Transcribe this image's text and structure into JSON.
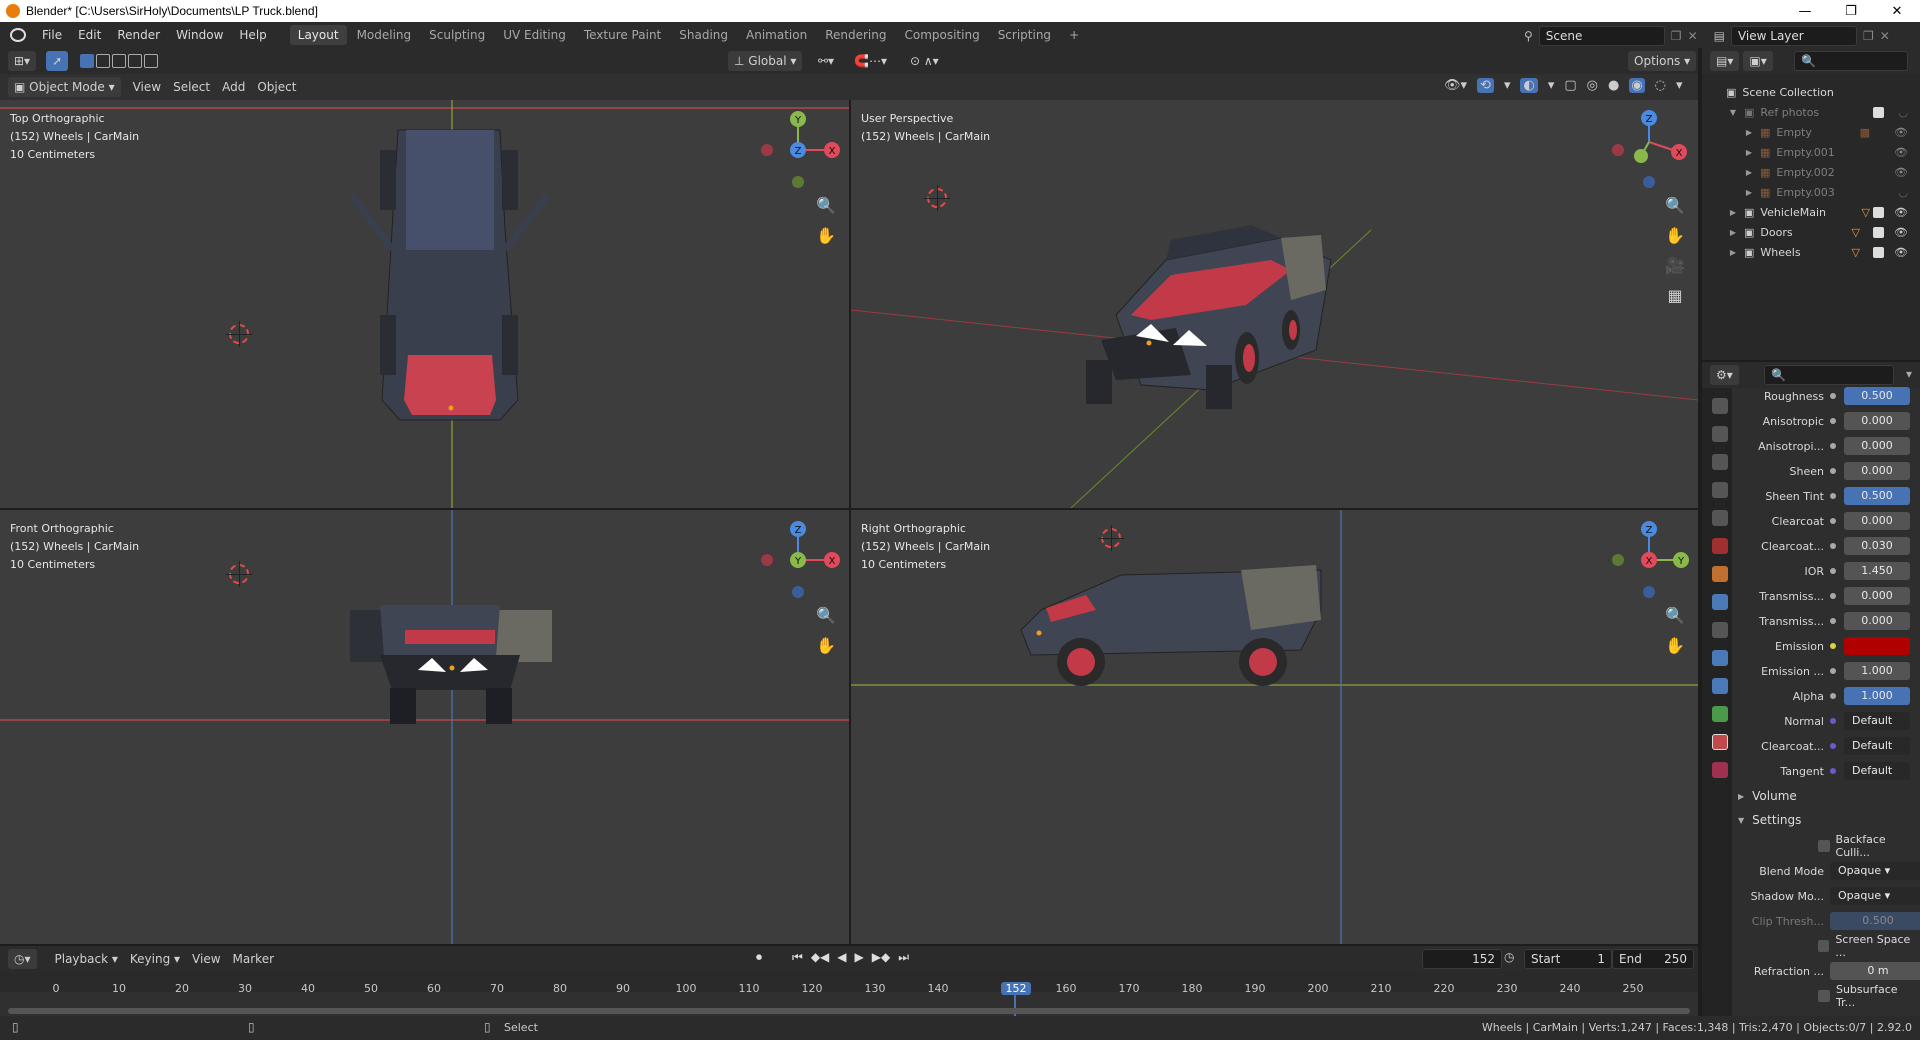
{
  "window": {
    "title": "Blender* [C:\\Users\\SirHoly\\Documents\\LP Truck.blend]",
    "minimize": "—",
    "maximize": "❐",
    "close": "✕"
  },
  "menu": [
    "File",
    "Edit",
    "Render",
    "Window",
    "Help"
  ],
  "workspaces": [
    "Layout",
    "Modeling",
    "Sculpting",
    "UV Editing",
    "Texture Paint",
    "Shading",
    "Animation",
    "Rendering",
    "Compositing",
    "Scripting"
  ],
  "workspace_add": "+",
  "scene": {
    "label": "Scene",
    "view_layer": "View Layer"
  },
  "viewport_header": {
    "mode": "Object Mode",
    "menus": [
      "View",
      "Select",
      "Add",
      "Object"
    ],
    "orientation": "Global",
    "options": "Options"
  },
  "viewports": [
    {
      "name": "Top Orthographic",
      "line2": "(152) Wheels | CarMain",
      "line3": "10 Centimeters"
    },
    {
      "name": "User Perspective",
      "line2": "(152) Wheels | CarMain",
      "line3": ""
    },
    {
      "name": "Front Orthographic",
      "line2": "(152) Wheels | CarMain",
      "line3": "10 Centimeters"
    },
    {
      "name": "Right Orthographic",
      "line2": "(152) Wheels | CarMain",
      "line3": "10 Centimeters"
    }
  ],
  "gizmo_labels": {
    "x": "X",
    "y": "Y",
    "z": "Z"
  },
  "outliner": {
    "root": "Scene Collection",
    "items": [
      {
        "label": "Ref photos",
        "dim": true
      },
      {
        "label": "Empty",
        "dim": true
      },
      {
        "label": "Empty.001",
        "dim": true
      },
      {
        "label": "Empty.002",
        "dim": true
      },
      {
        "label": "Empty.003",
        "dim": true
      },
      {
        "label": "VehicleMain",
        "dim": false
      },
      {
        "label": "Doors",
        "dim": false
      },
      {
        "label": "Wheels",
        "dim": false
      }
    ]
  },
  "properties": {
    "rows": [
      {
        "label": "Roughness",
        "value": "0.500",
        "style": "blue"
      },
      {
        "label": "Anisotropic",
        "value": "0.000",
        "style": ""
      },
      {
        "label": "Anisotropi...",
        "value": "0.000",
        "style": ""
      },
      {
        "label": "Sheen",
        "value": "0.000",
        "style": ""
      },
      {
        "label": "Sheen Tint",
        "value": "0.500",
        "style": "blue"
      },
      {
        "label": "Clearcoat",
        "value": "0.000",
        "style": ""
      },
      {
        "label": "Clearcoat...",
        "value": "0.030",
        "style": ""
      },
      {
        "label": "IOR",
        "value": "1.450",
        "style": ""
      },
      {
        "label": "Transmiss...",
        "value": "0.000",
        "style": ""
      },
      {
        "label": "Transmiss...",
        "value": "0.000",
        "style": ""
      },
      {
        "label": "Emission",
        "value": "",
        "style": "red"
      },
      {
        "label": "Emission ...",
        "value": "1.000",
        "style": ""
      },
      {
        "label": "Alpha",
        "value": "1.000",
        "style": "blue"
      },
      {
        "label": "Normal",
        "value": "Default",
        "style": "left"
      },
      {
        "label": "Clearcoat...",
        "value": "Default",
        "style": "left"
      },
      {
        "label": "Tangent",
        "value": "Default",
        "style": "left"
      }
    ],
    "volume": "Volume",
    "settings": "Settings",
    "backface": "Backface Culli...",
    "blend_mode_label": "Blend Mode",
    "blend_mode": "Opaque",
    "shadow_mode_label": "Shadow Mo...",
    "shadow_mode": "Opaque",
    "clip_label": "Clip Thresh...",
    "clip_value": "0.500",
    "screen_space": "Screen Space ...",
    "refraction_label": "Refraction ...",
    "refraction_value": "0 m",
    "subsurface": "Subsurface Tr..."
  },
  "timeline": {
    "menus": [
      "Playback",
      "Keying",
      "View",
      "Marker"
    ],
    "current_frame": "152",
    "start_label": "Start",
    "start": "1",
    "end_label": "End",
    "end": "250",
    "ticks": [
      "0",
      "10",
      "20",
      "30",
      "40",
      "50",
      "60",
      "70",
      "80",
      "90",
      "100",
      "110",
      "120",
      "130",
      "140",
      "152",
      "160",
      "170",
      "180",
      "190",
      "200",
      "210",
      "220",
      "230",
      "240",
      "250"
    ],
    "playhead_label": "152"
  },
  "status": {
    "select": "Select",
    "stats": "Wheels | CarMain | Verts:1,247 | Faces:1,348 | Tris:2,470 | Objects:0/7 | 2.92.0"
  },
  "colors": {
    "accent": "#4772b3",
    "bg": "#3d3d3d",
    "emission": "#b00000"
  }
}
